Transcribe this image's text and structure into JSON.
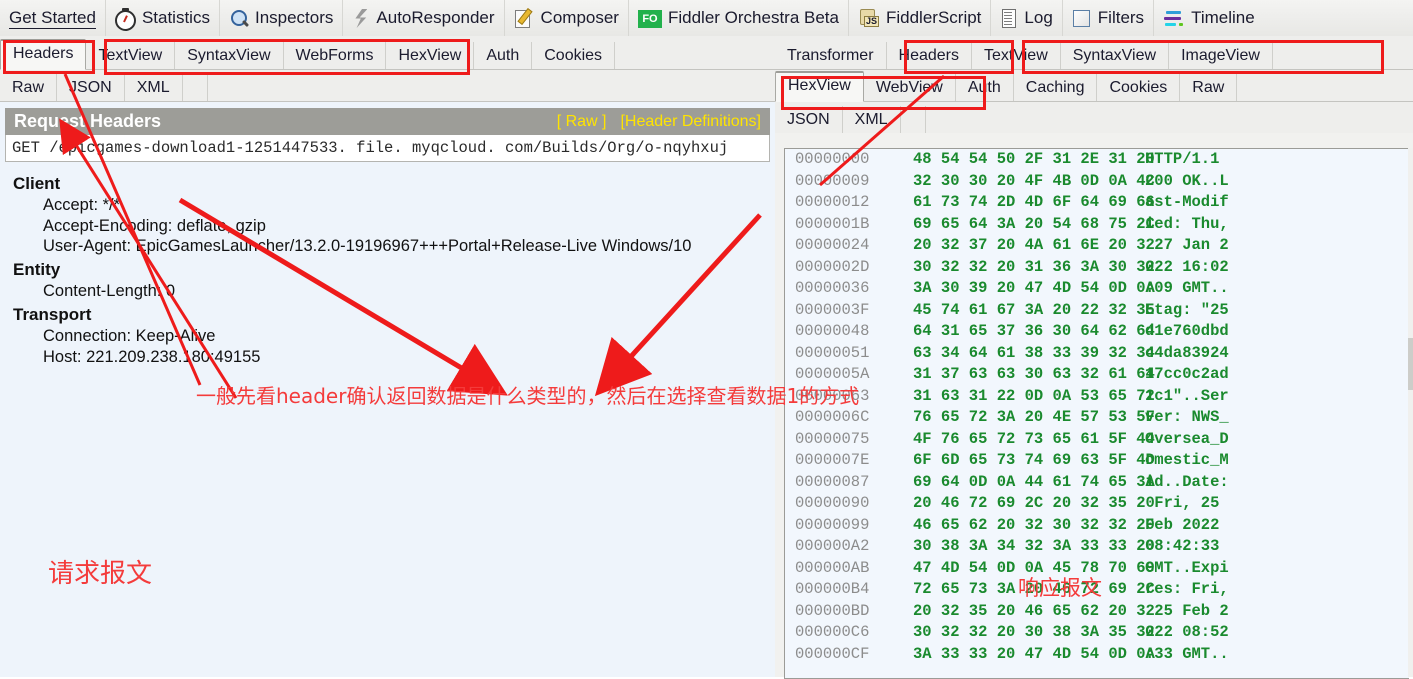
{
  "toolbar": {
    "items": [
      {
        "label": "Get Started",
        "icon": "none",
        "underlined": true
      },
      {
        "label": "Statistics",
        "icon": "stopwatch-icon",
        "underlined": false
      },
      {
        "label": "Inspectors",
        "icon": "magnifier-icon",
        "underlined": false
      },
      {
        "label": "AutoResponder",
        "icon": "bolt-icon",
        "underlined": false
      },
      {
        "label": "Composer",
        "icon": "composer-icon",
        "underlined": false
      },
      {
        "label": "Fiddler Orchestra Beta",
        "icon": "fo-badge-icon",
        "underlined": false
      },
      {
        "label": "FiddlerScript",
        "icon": "js-script-icon",
        "underlined": false
      },
      {
        "label": "Log",
        "icon": "log-icon",
        "underlined": false
      },
      {
        "label": "Filters",
        "icon": "filters-icon",
        "underlined": false
      },
      {
        "label": "Timeline",
        "icon": "timeline-icon",
        "underlined": false
      }
    ]
  },
  "request_panel": {
    "tabs_row1": [
      "Headers",
      "TextView",
      "SyntaxView",
      "WebForms",
      "HexView",
      "Auth",
      "Cookies"
    ],
    "tabs_row1_selected": "Headers",
    "tabs_row2": [
      "Raw",
      "JSON",
      "XML"
    ],
    "title": "Request Headers",
    "title_links": [
      "[ Raw ]",
      "[Header Definitions]"
    ],
    "request_line": "GET /epicgames-download1-1251447533. file. myqcloud. com/Builds/Org/o-nqyhxuj",
    "groups": [
      {
        "name": "Client",
        "headers": [
          "Accept: */*",
          "Accept-Encoding: deflate, gzip",
          "User-Agent: EpicGamesLauncher/13.2.0-19196967+++Portal+Release-Live Windows/10"
        ]
      },
      {
        "name": "Entity",
        "headers": [
          "Content-Length: 0"
        ]
      },
      {
        "name": "Transport",
        "headers": [
          "Connection: Keep-Alive",
          "Host: 221.209.238.180:49155"
        ]
      }
    ]
  },
  "response_panel": {
    "tabs_row1": [
      "Transformer",
      "Headers",
      "TextView",
      "SyntaxView",
      "ImageView"
    ],
    "tabs_row2": [
      "HexView",
      "WebView",
      "Auth",
      "Caching",
      "Cookies",
      "Raw"
    ],
    "tabs_row2_selected": "HexView",
    "tabs_row3": [
      "JSON",
      "XML"
    ],
    "hex_rows": [
      {
        "offset": "00000000",
        "bytes": "48 54 54 50 2F 31 2E 31 20",
        "ascii": "HTTP/1.1"
      },
      {
        "offset": "00000009",
        "bytes": "32 30 30 20 4F 4B 0D 0A 4C",
        "ascii": "200 OK..L"
      },
      {
        "offset": "00000012",
        "bytes": "61 73 74 2D 4D 6F 64 69 66",
        "ascii": "ast-Modif"
      },
      {
        "offset": "0000001B",
        "bytes": "69 65 64 3A 20 54 68 75 2C",
        "ascii": "ied: Thu,"
      },
      {
        "offset": "00000024",
        "bytes": "20 32 37 20 4A 61 6E 20 32",
        "ascii": " 27 Jan 2"
      },
      {
        "offset": "0000002D",
        "bytes": "30 32 32 20 31 36 3A 30 32",
        "ascii": "022 16:02"
      },
      {
        "offset": "00000036",
        "bytes": "3A 30 39 20 47 4D 54 0D 0A",
        "ascii": ":09 GMT.."
      },
      {
        "offset": "0000003F",
        "bytes": "45 74 61 67 3A 20 22 32 35",
        "ascii": "Etag: \"25"
      },
      {
        "offset": "00000048",
        "bytes": "64 31 65 37 36 30 64 62 64",
        "ascii": "d1e760dbd"
      },
      {
        "offset": "00000051",
        "bytes": "63 34 64 61 38 33 39 32 34",
        "ascii": "c4da83924"
      },
      {
        "offset": "0000005A",
        "bytes": "31 37 63 63 30 63 32 61 64",
        "ascii": "17cc0c2ad"
      },
      {
        "offset": "00000063",
        "bytes": "31 63 31 22 0D 0A 53 65 72",
        "ascii": "1c1\"..Ser"
      },
      {
        "offset": "0000006C",
        "bytes": "76 65 72 3A 20 4E 57 53 5F",
        "ascii": "ver: NWS_"
      },
      {
        "offset": "00000075",
        "bytes": "4F 76 65 72 73 65 61 5F 44",
        "ascii": "Oversea_D"
      },
      {
        "offset": "0000007E",
        "bytes": "6F 6D 65 73 74 69 63 5F 4D",
        "ascii": "omestic_M"
      },
      {
        "offset": "00000087",
        "bytes": "69 64 0D 0A 44 61 74 65 3A",
        "ascii": "id..Date:"
      },
      {
        "offset": "00000090",
        "bytes": "20 46 72 69 2C 20 32 35 20",
        "ascii": " Fri, 25"
      },
      {
        "offset": "00000099",
        "bytes": "46 65 62 20 32 30 32 32 20",
        "ascii": "Feb 2022"
      },
      {
        "offset": "000000A2",
        "bytes": "30 38 3A 34 32 3A 33 33 20",
        "ascii": "08:42:33"
      },
      {
        "offset": "000000AB",
        "bytes": "47 4D 54 0D 0A 45 78 70 69",
        "ascii": "GMT..Expi"
      },
      {
        "offset": "000000B4",
        "bytes": "72 65 73 3A 20 46 72 69 2C",
        "ascii": "res: Fri,"
      },
      {
        "offset": "000000BD",
        "bytes": "20 32 35 20 46 65 62 20 32",
        "ascii": " 25 Feb 2"
      },
      {
        "offset": "000000C6",
        "bytes": "30 32 32 20 30 38 3A 35 32",
        "ascii": "022 08:52"
      },
      {
        "offset": "000000CF",
        "bytes": "3A 33 33 20 47 4D 54 0D 0A",
        "ascii": ":33 GMT.."
      }
    ]
  },
  "annotations": {
    "color": "#ee1b1b",
    "text_color": "#f43b3b",
    "request_label": "请求报文",
    "response_label": "响应报文",
    "main_note": "一般先看header确认返回数据是什么类型的，然后在选择查看数据1的方式"
  }
}
